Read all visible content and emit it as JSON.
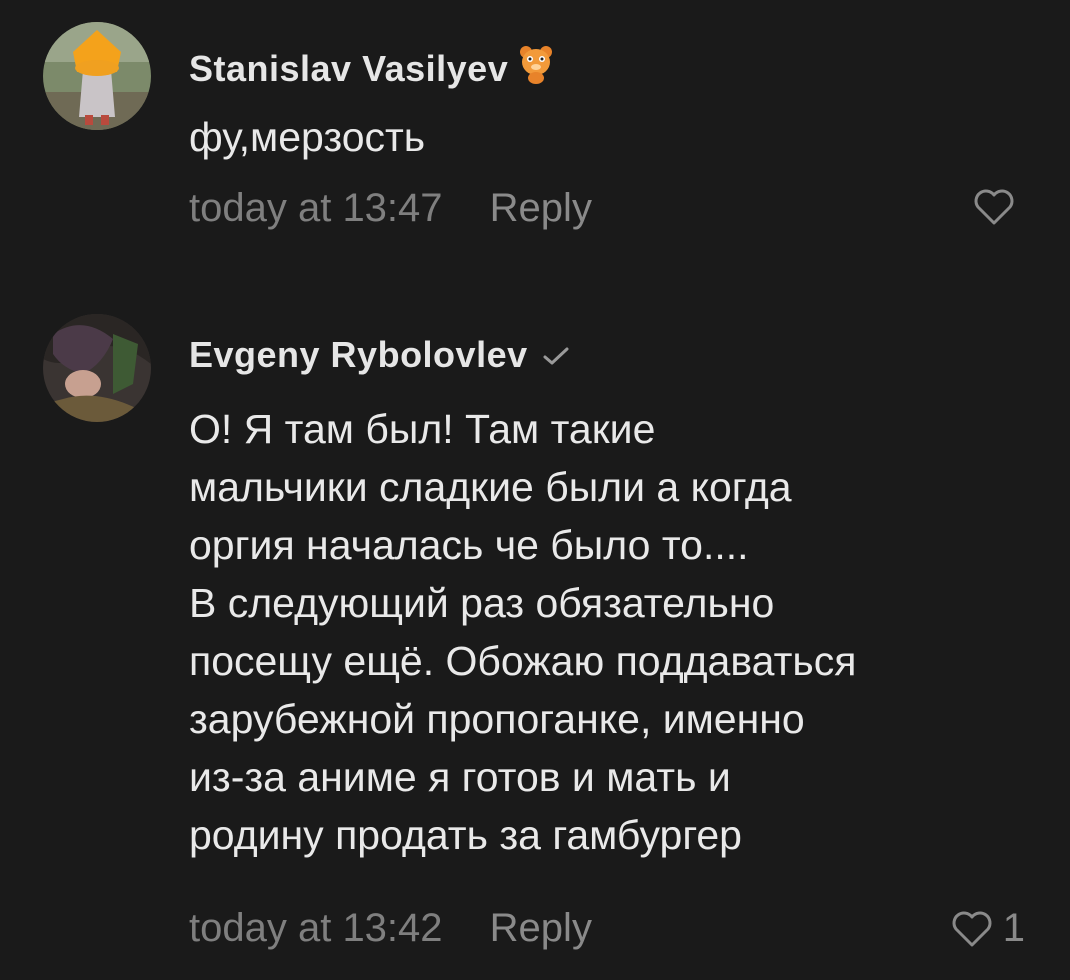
{
  "comments": [
    {
      "author": "Stanislav Vasilyev",
      "text": "фу,мерзость",
      "time": "today at 13:47",
      "reply_label": "Reply",
      "like_count": ""
    },
    {
      "author": "Evgeny Rybolovlev",
      "text": "О! Я там был! Там такие\nмальчики сладкие были а когда\nоргия началась че было то....\nВ следующий раз обязательно\nпосещу ещё. Обожаю поддаваться\nзарубежной пропоганке, именно\nиз-за аниме я готов и мать и\nродину продать за гамбургер",
      "time": "today at 13:42",
      "reply_label": "Reply",
      "like_count": "1"
    }
  ],
  "icons": {
    "badge_1": "bear-sticker-icon",
    "badge_2": "checkmark-icon",
    "like": "heart-outline-icon"
  },
  "colors": {
    "background": "#1a1a1a",
    "text_primary": "#e9e9e9",
    "text_secondary": "#7f7f7f"
  }
}
